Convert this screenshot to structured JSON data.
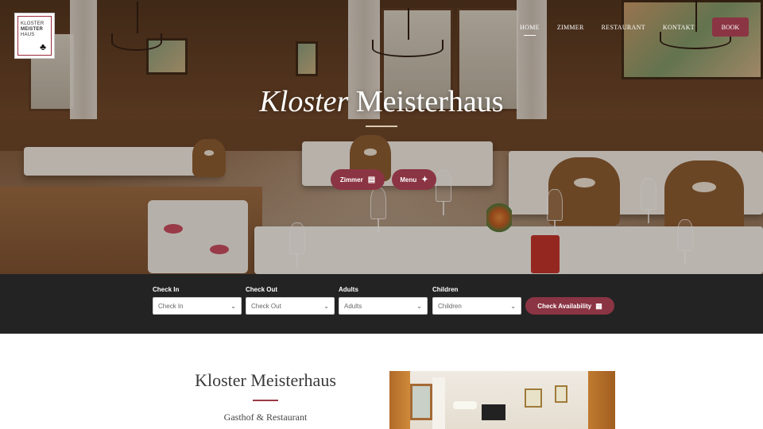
{
  "logo": {
    "line1": "KLOSTER",
    "line2": "MEISTER",
    "line3": "HAUS"
  },
  "nav": {
    "items": [
      {
        "label": "HOME",
        "active": true
      },
      {
        "label": "ZIMMER",
        "active": false
      },
      {
        "label": "RESTAURANT",
        "active": false
      },
      {
        "label": "KONTAKT",
        "active": false
      }
    ],
    "book_label": "BOOK"
  },
  "hero": {
    "title_italic": "Kloster",
    "title_regular": "Meisterhaus",
    "buttons": [
      {
        "label": "Zimmer",
        "icon": "bed-icon"
      },
      {
        "label": "Menu",
        "icon": "utensils-icon"
      }
    ]
  },
  "booking": {
    "fields": [
      {
        "label": "Check In",
        "placeholder": "Check In"
      },
      {
        "label": "Check Out",
        "placeholder": "Check Out"
      },
      {
        "label": "Adults",
        "placeholder": "Adults"
      },
      {
        "label": "Children",
        "placeholder": "Children"
      }
    ],
    "submit_label": "Check Availability",
    "submit_icon": "calendar-icon"
  },
  "intro": {
    "title": "Kloster Meisterhaus",
    "subtitle": "Gasthof & Restaurant"
  },
  "colors": {
    "accent": "#8b3443",
    "booking_bar": "#232323"
  }
}
